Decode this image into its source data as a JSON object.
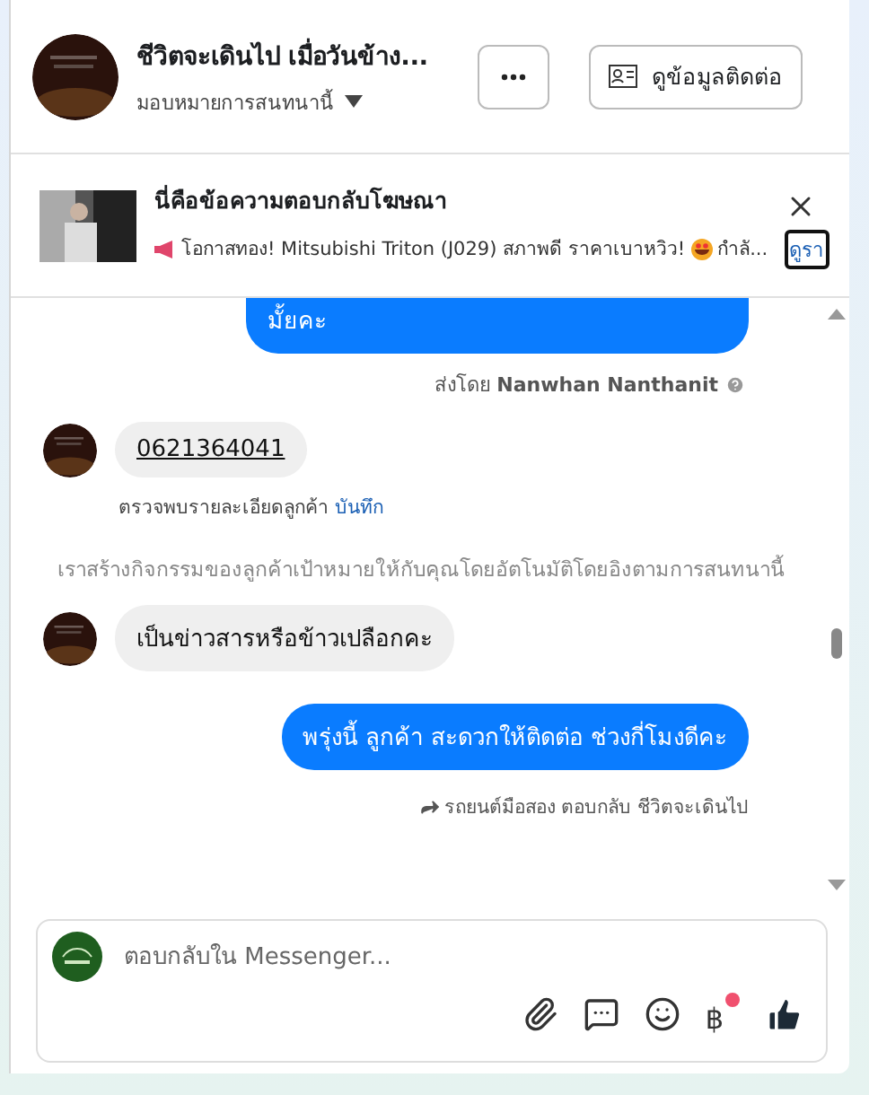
{
  "header": {
    "title": "ชีวิตจะเดินไป เมื่อวันข้าง...",
    "assign": "มอบหมายการสนทนานี้",
    "buttons": [
      {
        "kind": "more"
      },
      {
        "kind": "contact",
        "label": "ดูข้อมูลติดต่อ"
      }
    ]
  },
  "ad": {
    "title": "นี่คือข้อความตอบกลับโฆษณา",
    "text": "โอกาสทอง! Mitsubishi Triton (J029) สภาพดี ราคาเบาหวิว!",
    "text_end": "กำลั...",
    "link": "ดูรา"
  },
  "messages": [
    {
      "kind": "outgoing",
      "text": "มั้ยคะ",
      "cut": true
    },
    {
      "kind": "sender",
      "prefix": "ส่งโดย",
      "name": "Nanwhan Nanthanit"
    },
    {
      "kind": "incoming",
      "text": "0621364041",
      "link": true
    },
    {
      "kind": "detected",
      "text": "ตรวจพบรายละเอียดลูกค้า",
      "action": "บันทึก"
    },
    {
      "kind": "notice",
      "text": "เราสร้างกิจกรรมของลูกค้าเป้าหมายให้กับคุณโดยอัตโนมัติโดยอิงตามการสนทนานี้"
    },
    {
      "kind": "incoming",
      "text": "เป็นข่าวสารหรือข้าวเปลือกคะ",
      "link": false
    },
    {
      "kind": "outgoing",
      "text": "พรุ่งนี้ ลูกค้า สะดวกให้ติดต่อ ช่วงกี่โมงดีคะ",
      "cut": false
    },
    {
      "kind": "reply",
      "text": "รถยนต์มือสอง ตอบกลับ ชีวิตจะเดินไป"
    }
  ],
  "composer": {
    "placeholder": "ตอบกลับใน Messenger...",
    "currency": "฿",
    "currency_dot": true
  }
}
